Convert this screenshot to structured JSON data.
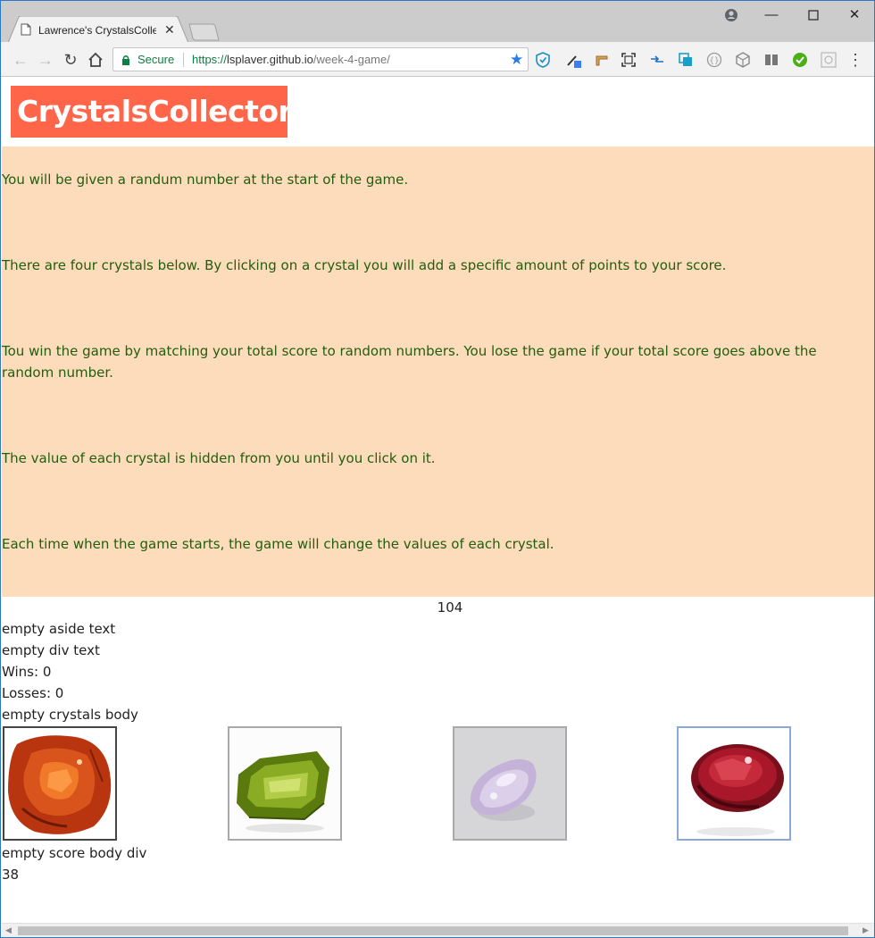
{
  "browser": {
    "tab_title": "Lawrence's CrystalsCollec",
    "secure_label": "Secure",
    "url_scheme": "https://",
    "url_host": "lsplaver.github.io",
    "url_path": "/week-4-game/"
  },
  "page": {
    "title": "CrystalsCollector!",
    "instructions": [
      "You will be given a randum number at the start of the game.",
      "There are four crystals below. By clicking on a crystal you will add a specific amount of points to your score.",
      "Tou win the game by matching your total score to random numbers. You lose the game if your total score goes above the random number.",
      "The value of each crystal is hidden from you until you click on it.",
      "Each time when the game starts, the game will change the values of each crystal."
    ],
    "random_number": "104",
    "aside_text": "empty aside text",
    "div_text": "empty div text",
    "wins": "Wins: 0",
    "losses": "Losses: 0",
    "crystals_body_text": "empty crystals body",
    "score_body_text": "empty score body div",
    "score": "38"
  },
  "colors": {
    "heading_bg": "#ff6548",
    "instructions_bg": "#fddcbb",
    "instructions_text": "#225d11"
  },
  "crystals": [
    {
      "name": "orange-crystal",
      "color": "#c8471a"
    },
    {
      "name": "green-crystal",
      "color": "#7b9a1e"
    },
    {
      "name": "lavender-crystal",
      "color": "#d4c6e4"
    },
    {
      "name": "red-crystal",
      "color": "#a8182a"
    }
  ]
}
